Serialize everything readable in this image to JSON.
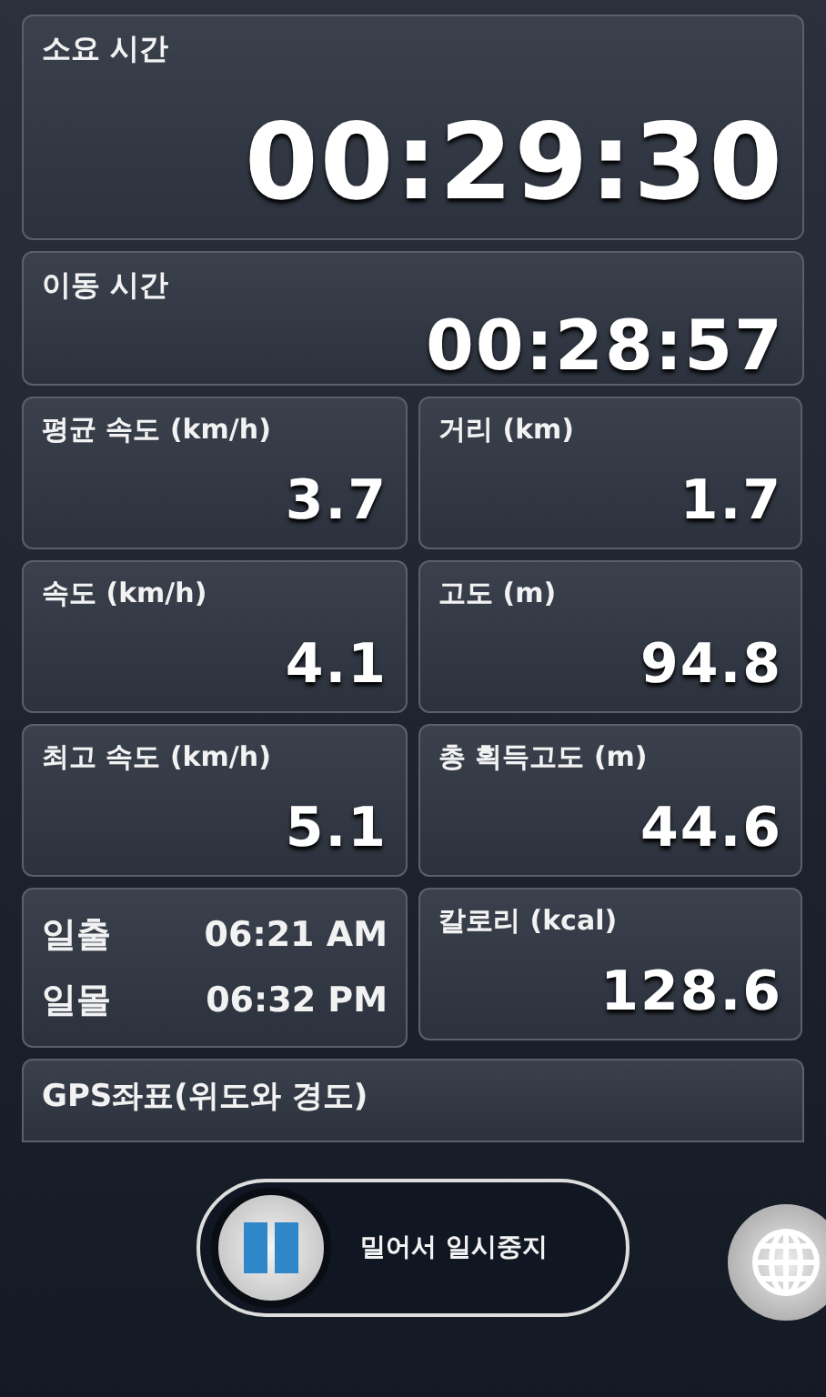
{
  "elapsed": {
    "label": "소요 시간",
    "value": "00:29:30"
  },
  "moving": {
    "label": "이동 시간",
    "value": "00:28:57"
  },
  "stats": [
    {
      "kind": "stat",
      "label": "평균 속도 (km/h)",
      "value": "3.7"
    },
    {
      "kind": "stat",
      "label": "거리 (km)",
      "value": "1.7"
    },
    {
      "kind": "stat",
      "label": "속도 (km/h)",
      "value": "4.1"
    },
    {
      "kind": "stat",
      "label": "고도 (m)",
      "value": "94.8"
    },
    {
      "kind": "stat",
      "label": "최고 속도 (km/h)",
      "value": "5.1"
    },
    {
      "kind": "stat",
      "label": "총 획득고도 (m)",
      "value": "44.6"
    },
    {
      "kind": "sun",
      "rows": [
        {
          "label": "일출",
          "value": "06:21 AM"
        },
        {
          "label": "일몰",
          "value": "06:32 PM"
        }
      ]
    },
    {
      "kind": "stat",
      "label": "칼로리 (kcal)",
      "value": "128.6"
    }
  ],
  "gps": {
    "label": "GPS좌표(위도와 경도)"
  },
  "slider": {
    "label": "밀어서 일시중지"
  }
}
